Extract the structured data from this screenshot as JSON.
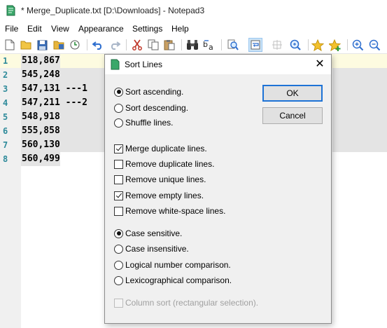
{
  "window": {
    "title": "* Merge_Duplicate.txt [D:\\Downloads] - Notepad3",
    "app_icon": "notepad3-icon"
  },
  "menu": {
    "items": [
      "File",
      "Edit",
      "View",
      "Appearance",
      "Settings",
      "Help"
    ]
  },
  "toolbar": {
    "buttons": [
      "new-icon",
      "open-icon",
      "save-icon",
      "save-as-icon",
      "browse-icon",
      "undo-icon",
      "redo-icon",
      "cut-icon",
      "copy-icon",
      "paste-icon",
      "find-icon",
      "replace-icon",
      "search-icon",
      "word-wrap-icon",
      "zoom-icon",
      "find-next-icon",
      "favorites-icon",
      "add-favorite-icon",
      "zoom-in-icon",
      "zoom-out-icon"
    ]
  },
  "editor": {
    "lines": [
      {
        "num": "1",
        "text": "518,867"
      },
      {
        "num": "2",
        "text": "545,248"
      },
      {
        "num": "3",
        "text": "547,131 ---1"
      },
      {
        "num": "4",
        "text": "547,211 ---2"
      },
      {
        "num": "5",
        "text": "548,918"
      },
      {
        "num": "6",
        "text": "555,858"
      },
      {
        "num": "7",
        "text": "560,130"
      },
      {
        "num": "8",
        "text": "560,499"
      }
    ],
    "colors": {
      "line_number": "#2e8a9a",
      "current_line": "#fdfbe0",
      "selection": "#e4e4e4"
    }
  },
  "dialog": {
    "title": "Sort Lines",
    "close": "✕",
    "sort_order": {
      "ascending": "Sort ascending.",
      "descending": "Sort descending.",
      "shuffle": "Shuffle lines.",
      "selected": "ascending"
    },
    "filters": {
      "merge_duplicate": {
        "label": "Merge duplicate lines.",
        "checked": true
      },
      "remove_duplicate": {
        "label": "Remove duplicate lines.",
        "checked": false
      },
      "remove_unique": {
        "label": "Remove unique lines.",
        "checked": false
      },
      "remove_empty": {
        "label": "Remove empty lines.",
        "checked": true
      },
      "remove_whitespace": {
        "label": "Remove white-space lines.",
        "checked": false
      }
    },
    "comparison": {
      "case_sensitive": "Case sensitive.",
      "case_insensitive": "Case insensitive.",
      "logical": "Logical number comparison.",
      "lexicographical": "Lexicographical comparison.",
      "selected": "case_sensitive"
    },
    "column_sort": {
      "label": "Column sort (rectangular selection).",
      "checked": false,
      "enabled": false
    },
    "ok_label": "OK",
    "cancel_label": "Cancel"
  }
}
